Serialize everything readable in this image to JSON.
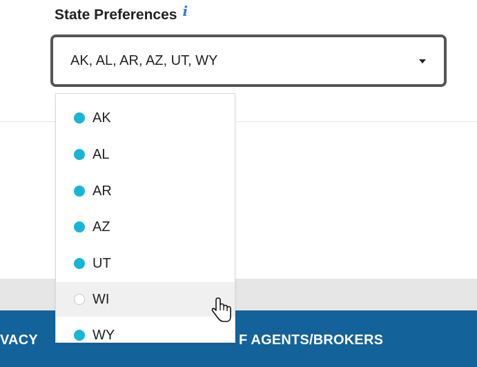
{
  "field": {
    "label": "State Preferences",
    "info_glyph": "i",
    "selected_value": "AK, AL, AR, AZ, UT, WY"
  },
  "dropdown": {
    "options": [
      {
        "label": "AK",
        "selected": true
      },
      {
        "label": "AL",
        "selected": true
      },
      {
        "label": "AR",
        "selected": true
      },
      {
        "label": "AZ",
        "selected": true
      },
      {
        "label": "UT",
        "selected": true
      },
      {
        "label": "WI",
        "selected": false,
        "hovered": true
      },
      {
        "label": "WY",
        "selected": true
      }
    ]
  },
  "footer": {
    "left_text": "VACY",
    "right_text": "F AGENTS/BROKERS"
  },
  "colors": {
    "accent": "#16b7d4",
    "footer_bg": "#14629a",
    "info_icon": "#2a7be4"
  }
}
